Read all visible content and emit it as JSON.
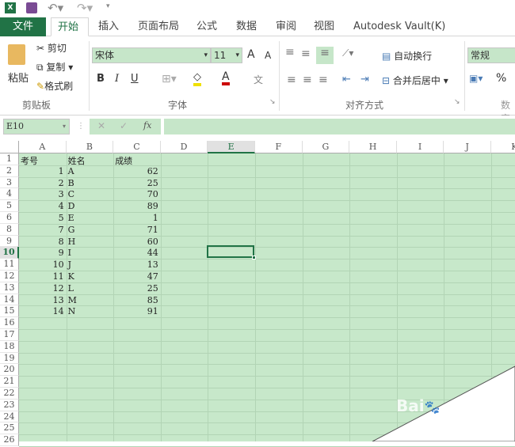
{
  "titlebar": {
    "icons": [
      "excel-icon",
      "save-icon",
      "undo-icon",
      "redo-icon",
      "customize-icon"
    ]
  },
  "tabs": [
    {
      "label": "文件"
    },
    {
      "label": "开始"
    },
    {
      "label": "插入"
    },
    {
      "label": "页面布局"
    },
    {
      "label": "公式"
    },
    {
      "label": "数据"
    },
    {
      "label": "审阅"
    },
    {
      "label": "视图"
    },
    {
      "label": "Autodesk Vault(K)"
    }
  ],
  "ribbon": {
    "clipboard": {
      "paste": "粘贴",
      "cut": "剪切",
      "copy": "复制",
      "format_painter": "格式刷",
      "label": "剪贴板"
    },
    "font": {
      "name": "宋体",
      "size": "11",
      "bold": "B",
      "italic": "I",
      "underline": "U",
      "font_color": "A",
      "grow": "A",
      "shrink": "A",
      "phonetic": "文",
      "label": "字体"
    },
    "alignment": {
      "wrap": "自动换行",
      "merge": "合并后居中",
      "label": "对齐方式"
    },
    "number": {
      "format": "常规",
      "percent": "%",
      "label": "数字"
    }
  },
  "formula_bar": {
    "name_box": "E10",
    "fx": "fx",
    "cancel": "✕",
    "enter": "✓",
    "value": ""
  },
  "columns": [
    "A",
    "B",
    "C",
    "D",
    "E",
    "F",
    "G",
    "H",
    "I",
    "J",
    "K"
  ],
  "selected_column": "E",
  "rows": [
    "1",
    "2",
    "3",
    "4",
    "5",
    "6",
    "8",
    "9",
    "10",
    "11",
    "12",
    "13",
    "14",
    "15",
    "16",
    "17",
    "18",
    "19",
    "20",
    "21",
    "22",
    "23",
    "24",
    "25",
    "26"
  ],
  "selected_row": "10",
  "table": {
    "headers": [
      "考号",
      "姓名",
      "成绩"
    ],
    "data": [
      [
        "1",
        "A",
        "62"
      ],
      [
        "2",
        "B",
        "25"
      ],
      [
        "3",
        "C",
        "70"
      ],
      [
        "4",
        "D",
        "89"
      ],
      [
        "5",
        "E",
        "1"
      ],
      [
        "7",
        "G",
        "71"
      ],
      [
        "8",
        "H",
        "60"
      ],
      [
        "9",
        "I",
        "44"
      ],
      [
        "10",
        "J",
        "13"
      ],
      [
        "11",
        "K",
        "47"
      ],
      [
        "12",
        "L",
        "25"
      ],
      [
        "13",
        "M",
        "85"
      ],
      [
        "14",
        "N",
        "91"
      ]
    ]
  },
  "watermark": "Baidu",
  "colors": {
    "accent": "#217346",
    "sheet_bg": "#c7e8ca"
  }
}
